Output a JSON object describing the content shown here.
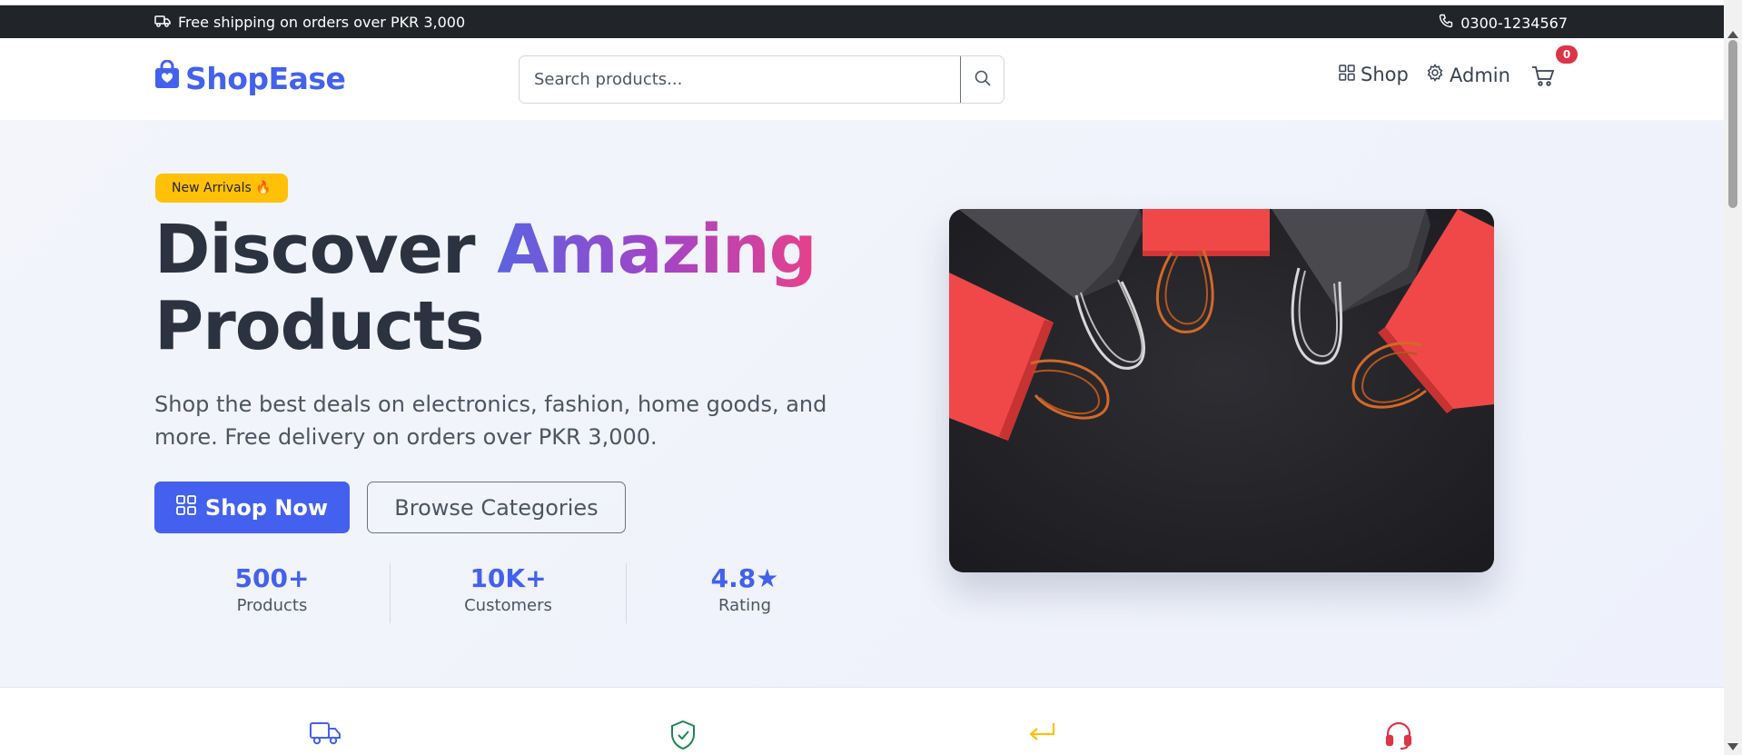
{
  "announcement": {
    "shipping_text": "Free shipping on orders over PKR 3,000",
    "phone": "0300-1234567"
  },
  "header": {
    "logo_text": "ShopEase",
    "search_placeholder": "Search products...",
    "nav": {
      "shop_label": "Shop",
      "admin_label": "Admin"
    },
    "cart_count": "0"
  },
  "hero": {
    "badge_text": "New Arrivals 🔥",
    "title_part1": "Discover ",
    "title_highlight": "Amazing",
    "title_part2": "Products",
    "lead": "Shop the best deals on electronics, fashion, home goods, and more. Free delivery on orders over PKR 3,000.",
    "primary_button": "Shop Now",
    "secondary_button": "Browse Categories",
    "stats": [
      {
        "value": "500+",
        "label": "Products"
      },
      {
        "value": "10K+",
        "label": "Customers"
      },
      {
        "value": "4.8★",
        "label": "Rating"
      }
    ]
  },
  "features": [
    {
      "icon": "truck-icon",
      "color": "#4361ee"
    },
    {
      "icon": "shield-check-icon",
      "color": "#198754"
    },
    {
      "icon": "return-arrow-icon",
      "color": "#ffc107"
    },
    {
      "icon": "headset-icon",
      "color": "#dc3545"
    }
  ],
  "colors": {
    "brand": "#4361ee",
    "announce_bg": "#212529",
    "badge_bg": "#ffc107",
    "cart_badge": "#dc3545"
  }
}
